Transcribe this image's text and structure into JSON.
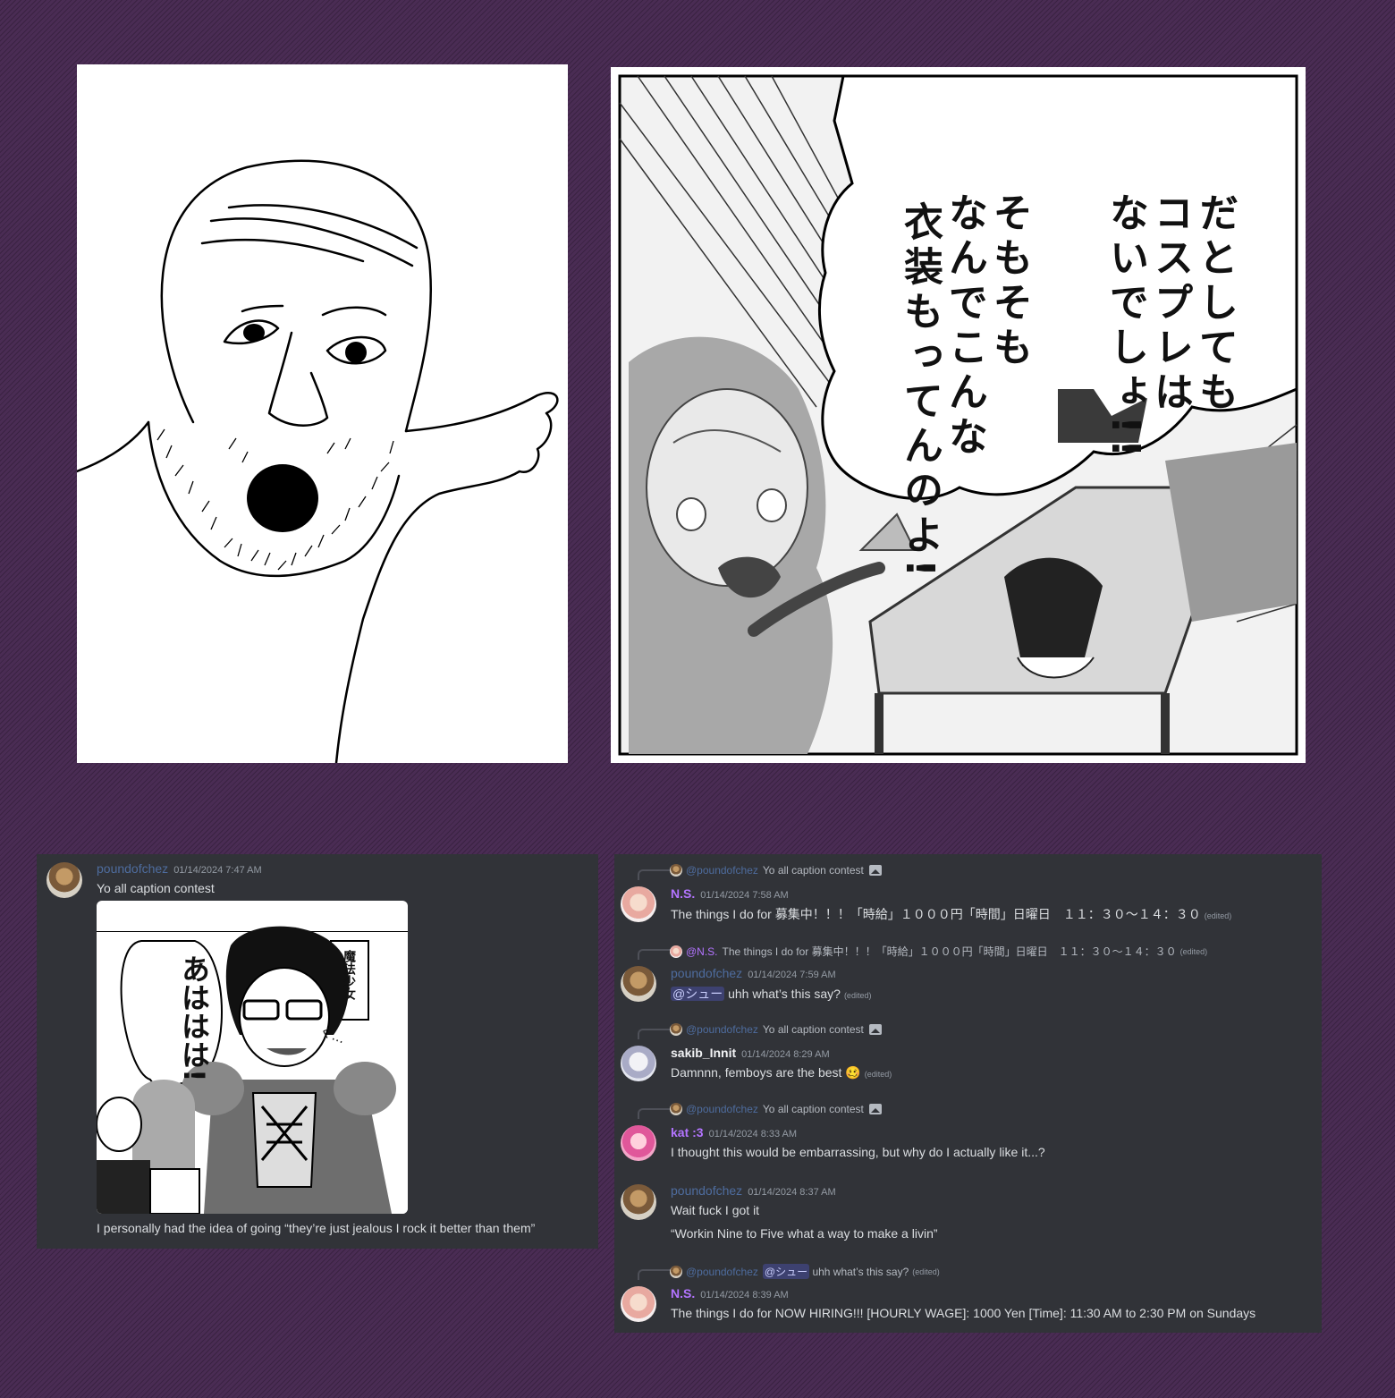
{
  "manga_text": {
    "col1": "だとしても",
    "col2": "コスプレは",
    "col3": "ないでしょ!!",
    "col4": "そもそも",
    "col5": "なんでこんな",
    "col6": "衣装もってんのよ!"
  },
  "attachment_text": {
    "laugh": "あははは!",
    "box": "魔法少女",
    "sfx": "ぐ…"
  },
  "left_chat": {
    "username": "poundofchez",
    "timestamp": "01/14/2024 7:47 AM",
    "message1": "Yo all caption contest",
    "message2": "I personally had the idea of going “they’re just jealous I rock it better than them”"
  },
  "right_chat": {
    "m1": {
      "reply_name": "@poundofchez",
      "reply_text": "Yo all caption contest",
      "username": "N.S.",
      "timestamp": "01/14/2024 7:58 AM",
      "text": "The things I do for 募集中！！！「時給」１０００円「時間」日曜日　１１：３０〜１４：３０",
      "edited": "(edited)"
    },
    "m2": {
      "reply_name": "@N.S.",
      "reply_text": "The things I do for 募集中！！！「時給」１０００円「時間」日曜日　１１：３０〜１４：３０",
      "reply_edited": "(edited)",
      "username": "poundofchez",
      "timestamp": "01/14/2024 7:59 AM",
      "mention": "@シュー",
      "text": "uhh what’s this say?",
      "edited": "(edited)"
    },
    "m3": {
      "reply_name": "@poundofchez",
      "reply_text": "Yo all caption contest",
      "username": "sakib_Innit",
      "timestamp": "01/14/2024 8:29 AM",
      "text": "Damnnn, femboys are the best",
      "emoji": "🥴",
      "edited": "(edited)"
    },
    "m4": {
      "reply_name": "@poundofchez",
      "reply_text": "Yo all caption contest",
      "username": "kat :3",
      "timestamp": "01/14/2024 8:33 AM",
      "text": "I thought this would be embarrassing, but why do I actually like it...?"
    },
    "m5": {
      "username": "poundofchez",
      "timestamp": "01/14/2024 8:37 AM",
      "text1": "Wait fuck I got it",
      "text2": "“Workin Nine to Five what a way to make a livin”"
    },
    "m6": {
      "reply_name": "@poundofchez",
      "reply_mention": "@シュー",
      "reply_text": "uhh what’s this say?",
      "reply_edited": "(edited)",
      "username": "N.S.",
      "timestamp": "01/14/2024 8:39 AM",
      "text": "The things I do for NOW HIRING!!! [HOURLY WAGE]: 1000 Yen [Time]: 11:30 AM to 2:30 PM on Sundays"
    }
  },
  "colors": {
    "background": "#4a2c54",
    "chat_bg": "#313338",
    "username_blue": "#4e6c9e",
    "username_purple": "#b374ff"
  }
}
